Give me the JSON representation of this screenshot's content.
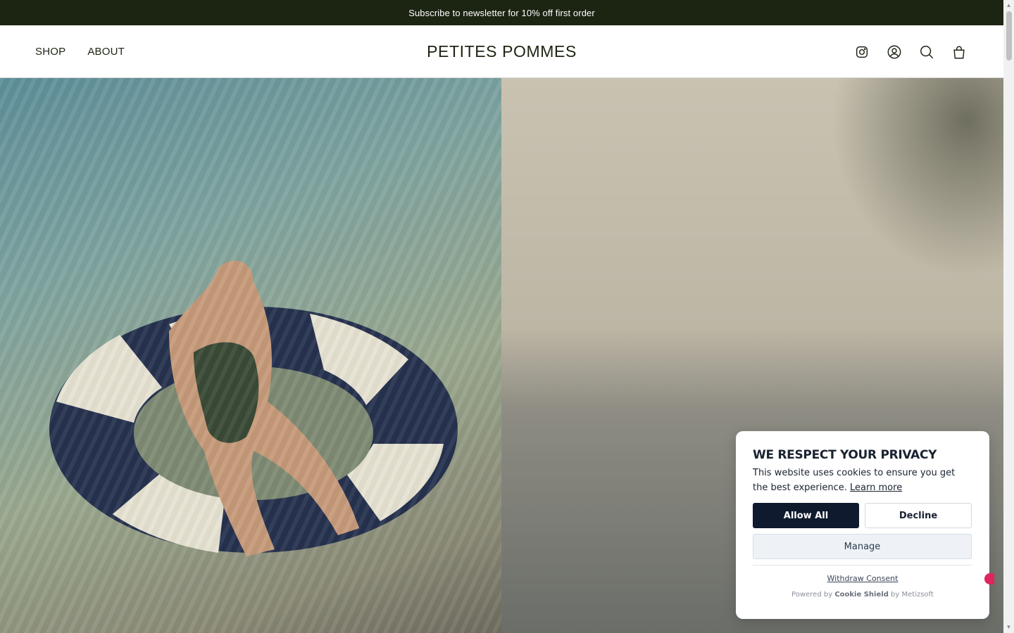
{
  "announcement": {
    "text": "Subscribe to newsletter for 10% off first order"
  },
  "header": {
    "nav": [
      {
        "label": "SHOP"
      },
      {
        "label": "ABOUT"
      }
    ],
    "logo": "PETITES POMMES",
    "icons": [
      "instagram-icon",
      "account-icon",
      "search-icon",
      "cart-icon"
    ]
  },
  "cookie_banner": {
    "title": "WE RESPECT YOUR PRIVACY",
    "text": "This website uses cookies to ensure you get the best experience.",
    "learn_more": "Learn more",
    "allow_label": "Allow All",
    "decline_label": "Decline",
    "manage_label": "Manage",
    "withdraw_label": "Withdraw Consent",
    "powered_prefix": "Powered by",
    "powered_brand": "Cookie Shield",
    "powered_suffix": "by Metizsoft"
  },
  "colors": {
    "announcement_bg": "#1c2412",
    "primary_button": "#0f1a2e",
    "chat_badge": "#e0245e"
  }
}
